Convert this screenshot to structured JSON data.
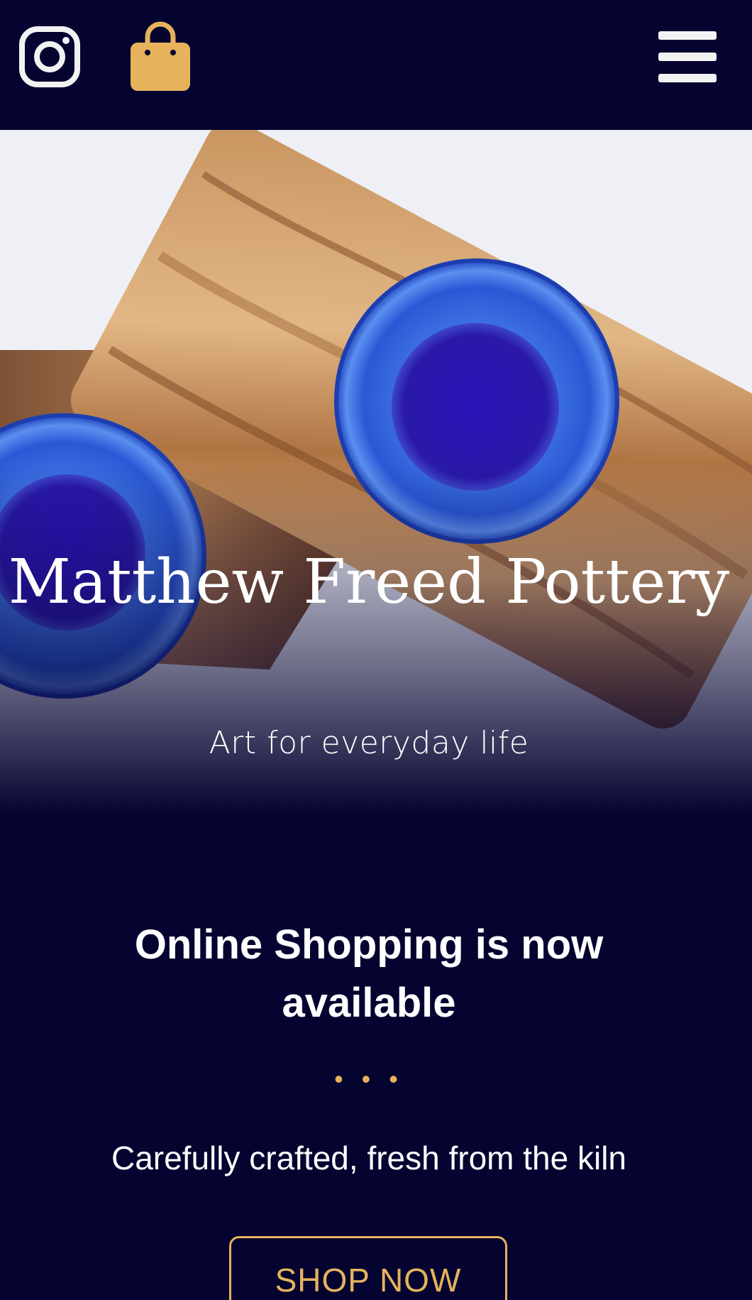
{
  "header": {
    "icons": [
      "instagram-icon",
      "shopping-bag-icon",
      "hamburger-menu-icon"
    ],
    "colors": {
      "background": "#050330",
      "bag": "#e6b35c",
      "icon_light": "#f2f2f2"
    }
  },
  "hero": {
    "title": "Matthew Freed Pottery",
    "subtitle": "Art for everyday life",
    "image": "blue glazed ceramic bowls on wooden serving boards"
  },
  "promo": {
    "title": "Online Shopping is now available",
    "dots": "• • •",
    "subtitle": "Carefully crafted, fresh from the kiln",
    "cta_label": "SHOP NOW",
    "accent": "#e6b35c"
  }
}
